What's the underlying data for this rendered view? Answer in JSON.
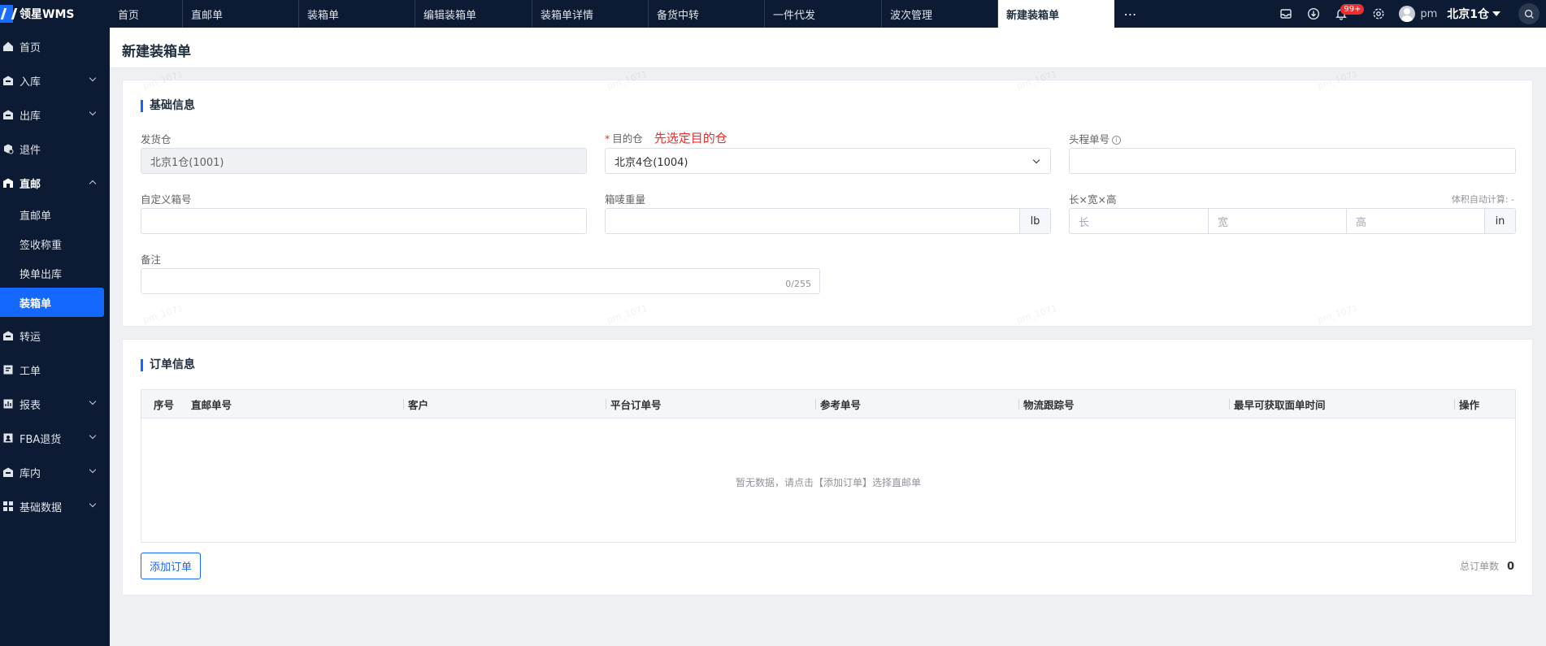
{
  "app": {
    "logo_text": "领星WMS"
  },
  "tabs": [
    {
      "label": "首页"
    },
    {
      "label": "直邮单"
    },
    {
      "label": "装箱单"
    },
    {
      "label": "编辑装箱单"
    },
    {
      "label": "装箱单详情"
    },
    {
      "label": "备货中转"
    },
    {
      "label": "一件代发"
    },
    {
      "label": "波次管理"
    },
    {
      "label": "新建装箱单"
    }
  ],
  "topbar": {
    "badge": "99+",
    "user": "pm",
    "warehouse": "北京1仓"
  },
  "sidebar": {
    "items": [
      {
        "label": "首页"
      },
      {
        "label": "入库"
      },
      {
        "label": "出库"
      },
      {
        "label": "退件"
      },
      {
        "label": "直邮"
      },
      {
        "label": "转运"
      },
      {
        "label": "工单"
      },
      {
        "label": "报表"
      },
      {
        "label": "FBA退货"
      },
      {
        "label": "库内"
      },
      {
        "label": "基础数据"
      }
    ],
    "sub_items": [
      {
        "label": "直邮单"
      },
      {
        "label": "签收称重"
      },
      {
        "label": "换单出库"
      },
      {
        "label": "装箱单"
      }
    ]
  },
  "page": {
    "title": "新建装箱单"
  },
  "basic": {
    "title": "基础信息",
    "from_wh_label": "发货仓",
    "from_wh_value": "北京1仓(1001)",
    "dest_wh_label": "目的仓",
    "dest_wh_hint": "先选定目的仓",
    "dest_wh_value": "北京4仓(1004)",
    "head_no_label": "头程单号",
    "custom_box_label": "自定义箱号",
    "weight_label": "箱唛重量",
    "weight_unit": "lb",
    "dims_label": "长×宽×高",
    "vol_auto": "体积自动计算: -",
    "len_ph": "长",
    "wid_ph": "宽",
    "hei_ph": "高",
    "dims_unit": "in",
    "remark_label": "备注",
    "remark_counter": "0/255"
  },
  "orders": {
    "title": "订单信息",
    "columns": [
      "序号",
      "直邮单号",
      "客户",
      "平台订单号",
      "参考单号",
      "物流跟踪号",
      "最早可获取面单时间",
      "操作"
    ],
    "empty_text": "暂无数据，请点击【添加订单】选择直邮单",
    "add_button": "添加订单",
    "total_label": "总订单数",
    "total_value": "0"
  },
  "watermark": "pm_1071"
}
